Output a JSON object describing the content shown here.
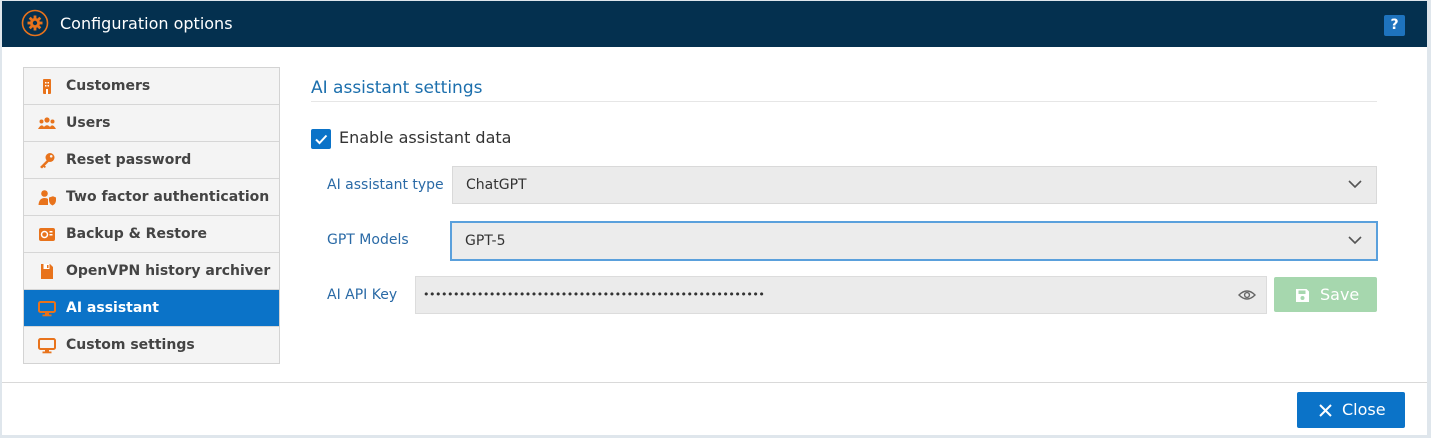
{
  "window": {
    "title": "Configuration options",
    "help_label": "?"
  },
  "sidebar": {
    "items": [
      {
        "label": "Customers",
        "icon": "building-icon"
      },
      {
        "label": "Users",
        "icon": "users-icon"
      },
      {
        "label": "Reset password",
        "icon": "key-icon"
      },
      {
        "label": "Two factor authentication",
        "icon": "user-shield-icon"
      },
      {
        "label": "Backup & Restore",
        "icon": "backup-icon"
      },
      {
        "label": "OpenVPN history archiver",
        "icon": "archive-icon"
      },
      {
        "label": "AI assistant",
        "icon": "monitor-icon",
        "active": true
      },
      {
        "label": "Custom settings",
        "icon": "monitor-icon"
      }
    ]
  },
  "main": {
    "section_title": "AI assistant settings",
    "enable_checkbox": {
      "label": "Enable assistant data",
      "checked": true
    },
    "assistant_type": {
      "label": "AI assistant type",
      "value": "ChatGPT"
    },
    "gpt_models": {
      "label": "GPT Models",
      "value": "GPT-5"
    },
    "api_key": {
      "label": "AI API Key",
      "value": "•••••••••••••••••••••••••••••••••••••••••••••••••••••••••"
    },
    "save_label": "Save"
  },
  "footer": {
    "close_label": "Close"
  },
  "colors": {
    "titlebar": "#04304f",
    "accent": "#0b73c8",
    "icon_orange": "#e8731c",
    "save_disabled": "#a6d7ae"
  }
}
